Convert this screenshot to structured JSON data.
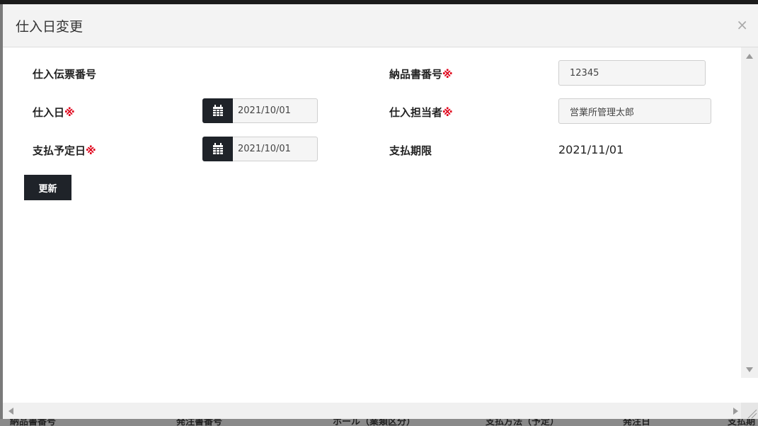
{
  "dialog": {
    "title": "仕入日変更",
    "close_label": "×"
  },
  "form": {
    "required_mark": "※",
    "purchase_slip_no": {
      "label": "仕入伝票番号",
      "value": ""
    },
    "delivery_note_no": {
      "label": "納品書番号",
      "value": "12345"
    },
    "purchase_date": {
      "label": "仕入日",
      "value": "2021/10/01"
    },
    "purchaser": {
      "label": "仕入担当者",
      "value": "営業所管理太郎"
    },
    "payment_due_date": {
      "label": "支払予定日",
      "value": "2021/10/01"
    },
    "payment_deadline": {
      "label": "支払期限",
      "value": "2021/11/01"
    },
    "update_button": "更新"
  },
  "background": {
    "columns": [
      "納品書番号",
      "発注書番号",
      "ホール（業類区分）",
      "支払方法（予定）",
      "発注日",
      "支払期"
    ]
  },
  "icons": {
    "calendar": "calendar-icon",
    "close": "close-icon"
  }
}
